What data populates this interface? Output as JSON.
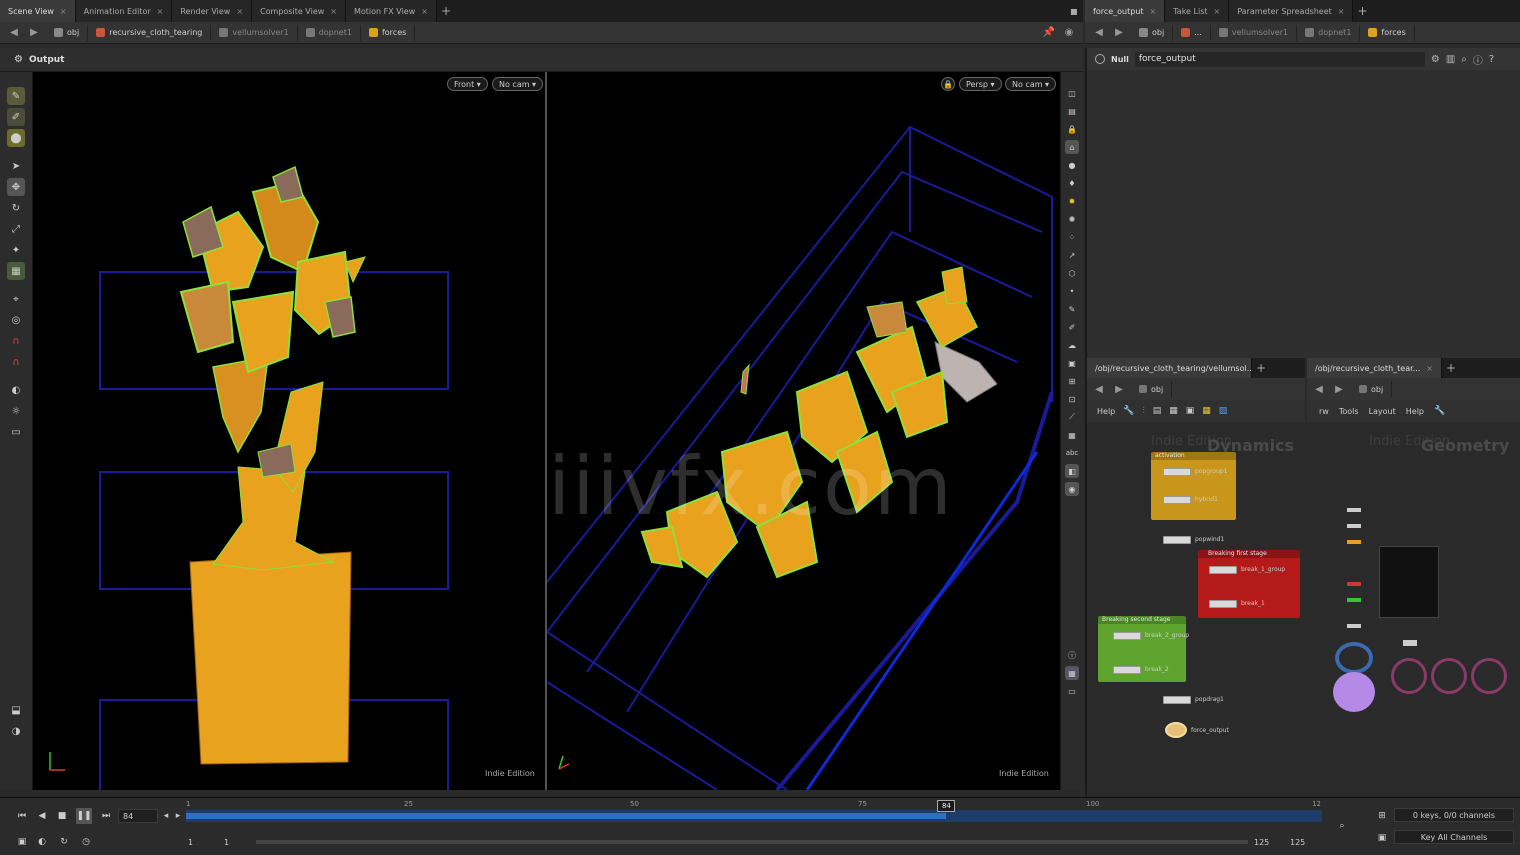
{
  "left_tabs": [
    {
      "label": "Scene View",
      "active": true
    },
    {
      "label": "Animation Editor",
      "active": false
    },
    {
      "label": "Render View",
      "active": false
    },
    {
      "label": "Composite View",
      "active": false
    },
    {
      "label": "Motion FX View",
      "active": false
    }
  ],
  "right_tabs": [
    {
      "label": "force_output",
      "active": true
    },
    {
      "label": "Take List",
      "active": false
    },
    {
      "label": "Parameter Spreadsheet",
      "active": false
    }
  ],
  "left_path": [
    "obj",
    "recursive_cloth_tearing",
    "vellumsolver1",
    "dopnet1",
    "forces"
  ],
  "right_path": [
    "obj",
    "...",
    "vellumsolver1",
    "dopnet1",
    "forces"
  ],
  "viewer": {
    "title": "Output",
    "left_view": "Front",
    "left_cam": "No cam",
    "right_view": "Persp",
    "right_cam": "No cam",
    "edition": "Indie Edition"
  },
  "param": {
    "node_type": "Null",
    "node_name": "force_output"
  },
  "watermark": "iiivfx.com",
  "network_left": {
    "tab": "/obj/recursive_cloth_tearing/vellumsol...",
    "path": "obj",
    "menu": [
      "Help"
    ],
    "edition": "Indie Edition",
    "context": "Dynamics",
    "boxes": [
      {
        "title": "activation",
        "color": "#c8961b"
      },
      {
        "title": "Breaking first stage",
        "color": "#b51a1a"
      },
      {
        "title": "Breaking second stage",
        "color": "#5fa32f"
      }
    ],
    "nodes": [
      "popgroup1",
      "hybrid1",
      "popwind1",
      "break_1_group",
      "break_1",
      "break_2_group",
      "break_2",
      "popdrag1",
      "force_output"
    ]
  },
  "network_right": {
    "tab": "/obj/recursive_cloth_tear...",
    "path": "obj",
    "menu": [
      "rw",
      "Tools",
      "Layout",
      "Help"
    ],
    "edition": "Indie Edition",
    "context": "Geometry"
  },
  "playbar": {
    "current_frame": "84",
    "ticks": [
      "1",
      "25",
      "50",
      "75",
      "100",
      "12"
    ],
    "start": "1",
    "range_start": "1",
    "range_end": "125",
    "end": "125",
    "keys_info": "0 keys, 0/0 channels",
    "key_all": "Key All Channels",
    "progress": 0.6694
  },
  "colors": {
    "cloth": "#e8a21e",
    "cloth_edge": "#8fe03a",
    "box": "#1a1a9a",
    "timeline": "#2d6fc4"
  }
}
